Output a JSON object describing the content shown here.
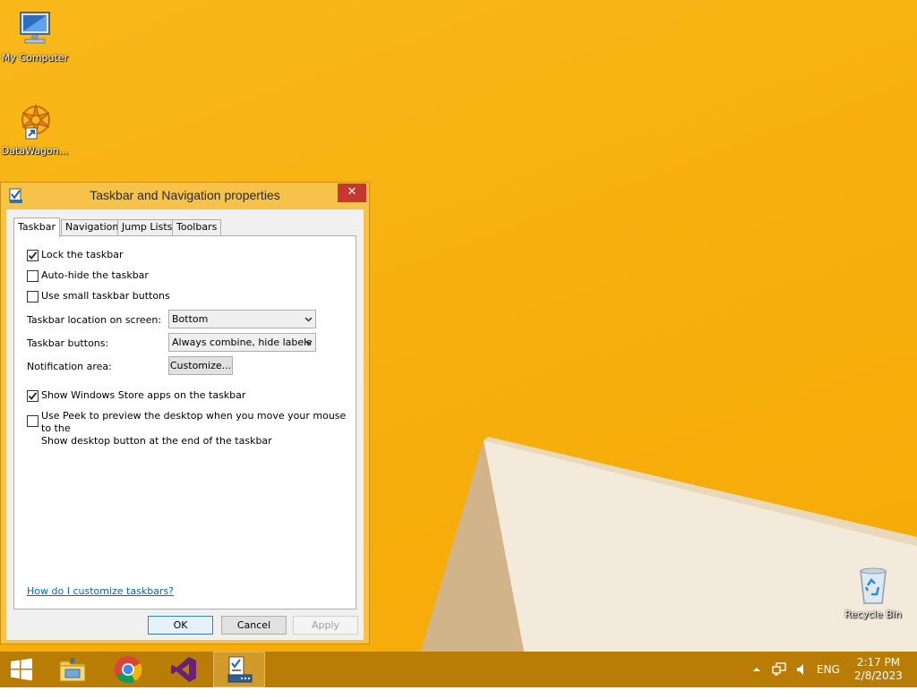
{
  "desktop": {
    "icons": [
      {
        "label": "My Computer",
        "icon": "my-computer-icon"
      },
      {
        "label": "DataWagon...",
        "icon": "datawagon-icon"
      },
      {
        "label": "Recycle Bin",
        "icon": "recycle-bin-icon"
      }
    ]
  },
  "dialog": {
    "title": "Taskbar and Navigation properties",
    "close_label": "✕",
    "tabs": [
      {
        "label": "Taskbar",
        "active": true
      },
      {
        "label": "Navigation",
        "active": false
      },
      {
        "label": "Jump Lists",
        "active": false
      },
      {
        "label": "Toolbars",
        "active": false
      }
    ],
    "options": {
      "lock_taskbar": {
        "label": "Lock the taskbar",
        "checked": true
      },
      "auto_hide": {
        "label": "Auto-hide the taskbar",
        "checked": false
      },
      "small_buttons": {
        "label": "Use small taskbar buttons",
        "checked": false
      },
      "store_apps": {
        "label": "Show Windows Store apps on the taskbar",
        "checked": true
      },
      "peek": {
        "label_line1": "Use Peek to preview the desktop when you move your mouse to the",
        "label_line2": "Show desktop button at the end of the taskbar",
        "checked": false
      }
    },
    "location": {
      "label": "Taskbar location on screen:",
      "value": "Bottom"
    },
    "buttons_setting": {
      "label": "Taskbar buttons:",
      "value": "Always combine, hide labels"
    },
    "notification": {
      "label": "Notification area:",
      "button": "Customize..."
    },
    "help_link": "How do I customize taskbars?",
    "footer": {
      "ok": "OK",
      "cancel": "Cancel",
      "apply": "Apply"
    }
  },
  "taskbar": {
    "items": [
      {
        "name": "start-button",
        "icon": "windows-logo-icon"
      },
      {
        "name": "file-explorer",
        "icon": "file-explorer-icon"
      },
      {
        "name": "chrome",
        "icon": "chrome-icon"
      },
      {
        "name": "visual-studio",
        "icon": "visual-studio-icon"
      },
      {
        "name": "taskbar-properties",
        "icon": "taskbar-properties-icon",
        "active": true
      }
    ],
    "tray": {
      "language": "ENG",
      "time": "2:17 PM",
      "date": "2/8/2023"
    }
  },
  "colors": {
    "wallpaper": "#f7b00f",
    "dialog_frame": "#f7c24a",
    "close_button": "#c7372e",
    "taskbar": "#b97d06",
    "link": "#0066cc"
  }
}
